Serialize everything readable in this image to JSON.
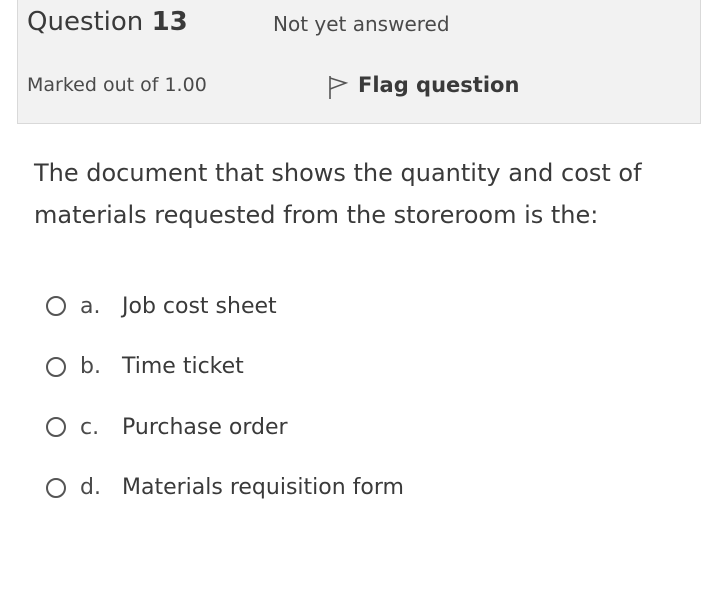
{
  "info": {
    "question_label": "Question",
    "question_number": "13",
    "state": "Not yet answered",
    "grade": "Marked out of 1.00",
    "flag_label": "Flag question",
    "flag_icon": "flag-outline-icon"
  },
  "question": {
    "text": "The document that shows the quantity and cost of materials requested from the storeroom is the:"
  },
  "answers": [
    {
      "letter": "a.",
      "text": "Job cost sheet",
      "selected": false
    },
    {
      "letter": "b.",
      "text": "Time ticket",
      "selected": false
    },
    {
      "letter": "c.",
      "text": "Purchase order",
      "selected": false
    },
    {
      "letter": "d.",
      "text": "Materials requisition form",
      "selected": false
    }
  ]
}
